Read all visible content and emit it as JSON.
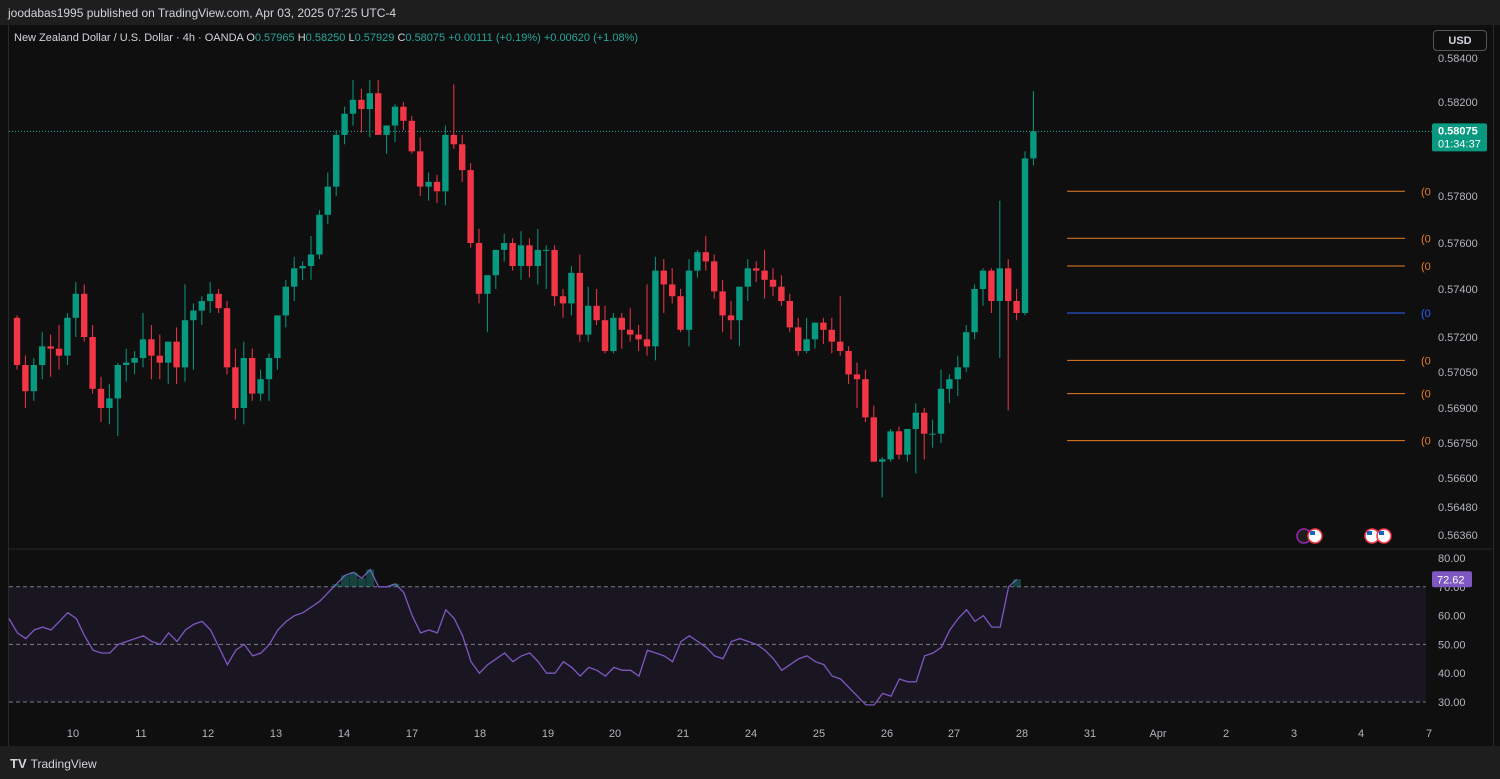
{
  "header": {
    "published": "joodabas1995 published on TradingView.com, Apr 03, 2025 07:25 UTC-4"
  },
  "legend": {
    "symbol": "New Zealand Dollar / U.S. Dollar · 4h · OANDA",
    "o_key": "O",
    "o_val": "0.57965",
    "h_key": "H",
    "h_val": "0.58250",
    "l_key": "L",
    "l_val": "0.57929",
    "c_key": "C",
    "c_val": "0.58075",
    "change": "+0.00111 (+0.19%)",
    "change2": "+0.00620 (+1.08%)"
  },
  "currency_button": "USD",
  "price_badge": {
    "price": "0.58075",
    "countdown": "01:34:37"
  },
  "rsi_badge": "72.62",
  "footer": {
    "brand": "TradingView",
    "logo": "TV"
  },
  "colors": {
    "up": "#089981",
    "down": "#f23645",
    "fib_orange": "#e67e22",
    "fib_blue": "#2962ff",
    "rsi": "#7e57c2",
    "last_price": "#26a69a"
  },
  "chart_data": [
    {
      "type": "candlestick",
      "y_ticks": [
        "0.58400",
        "0.58200",
        "0.57800",
        "0.57600",
        "0.57400",
        "0.57200",
        "0.57050",
        "0.56900",
        "0.56750",
        "0.56600",
        "0.56480",
        "0.56360"
      ],
      "y_tick_values": [
        0.584,
        0.582,
        0.578,
        0.576,
        0.574,
        0.572,
        0.5705,
        0.569,
        0.5675,
        0.566,
        0.5648,
        0.5636
      ],
      "x_ticks": [
        "10",
        "11",
        "12",
        "13",
        "14",
        "17",
        "18",
        "19",
        "20",
        "21",
        "24",
        "25",
        "26",
        "27",
        "28",
        "31",
        "Apr",
        "2",
        "3",
        "4",
        "7"
      ],
      "last_price": 0.58075,
      "fib_levels": [
        {
          "label": "(0",
          "value": 0.5782,
          "color": "orange"
        },
        {
          "label": "(0",
          "value": 0.5762,
          "color": "orange"
        },
        {
          "label": "(0",
          "value": 0.575,
          "color": "orange"
        },
        {
          "label": "(0",
          "value": 0.573,
          "color": "blue"
        },
        {
          "label": "(0",
          "value": 0.571,
          "color": "orange"
        },
        {
          "label": "(0",
          "value": 0.5696,
          "color": "orange"
        },
        {
          "label": "(0",
          "value": 0.5676,
          "color": "orange"
        }
      ],
      "candles": [
        [
          0.5728,
          0.5729,
          0.5706,
          0.5708
        ],
        [
          0.5708,
          0.5712,
          0.569,
          0.5697
        ],
        [
          0.5697,
          0.5711,
          0.5693,
          0.5708
        ],
        [
          0.5708,
          0.5722,
          0.5702,
          0.5716
        ],
        [
          0.5716,
          0.5721,
          0.5703,
          0.5715
        ],
        [
          0.5715,
          0.5725,
          0.5706,
          0.5712
        ],
        [
          0.5712,
          0.573,
          0.5708,
          0.5728
        ],
        [
          0.5728,
          0.5743,
          0.572,
          0.5738
        ],
        [
          0.5738,
          0.5742,
          0.5718,
          0.572
        ],
        [
          0.572,
          0.5725,
          0.5696,
          0.5698
        ],
        [
          0.5698,
          0.5703,
          0.5684,
          0.569
        ],
        [
          0.569,
          0.57,
          0.5683,
          0.5694
        ],
        [
          0.5694,
          0.5709,
          0.5678,
          0.5708
        ],
        [
          0.5708,
          0.5715,
          0.5701,
          0.5709
        ],
        [
          0.5709,
          0.5714,
          0.5704,
          0.5711
        ],
        [
          0.5711,
          0.573,
          0.5707,
          0.5719
        ],
        [
          0.5719,
          0.5725,
          0.5702,
          0.5712
        ],
        [
          0.5712,
          0.5721,
          0.5702,
          0.5709
        ],
        [
          0.5709,
          0.5718,
          0.57,
          0.5718
        ],
        [
          0.5718,
          0.5724,
          0.57,
          0.5707
        ],
        [
          0.5707,
          0.5742,
          0.5701,
          0.5727
        ],
        [
          0.5727,
          0.5734,
          0.5706,
          0.5731
        ],
        [
          0.5731,
          0.5737,
          0.5725,
          0.5735
        ],
        [
          0.5735,
          0.5743,
          0.573,
          0.5738
        ],
        [
          0.5738,
          0.574,
          0.573,
          0.5732
        ],
        [
          0.5732,
          0.5735,
          0.5704,
          0.5707
        ],
        [
          0.5707,
          0.5715,
          0.5685,
          0.569
        ],
        [
          0.569,
          0.5718,
          0.5683,
          0.5711
        ],
        [
          0.5711,
          0.5715,
          0.5693,
          0.5696
        ],
        [
          0.5696,
          0.5706,
          0.5693,
          0.5702
        ],
        [
          0.5702,
          0.5713,
          0.5693,
          0.5711
        ],
        [
          0.5711,
          0.5729,
          0.5706,
          0.5729
        ],
        [
          0.5729,
          0.5744,
          0.5724,
          0.5741
        ],
        [
          0.5741,
          0.5754,
          0.5735,
          0.5749
        ],
        [
          0.5749,
          0.5752,
          0.5744,
          0.575
        ],
        [
          0.575,
          0.5763,
          0.5744,
          0.5755
        ],
        [
          0.5755,
          0.5774,
          0.5753,
          0.5772
        ],
        [
          0.5772,
          0.579,
          0.5768,
          0.5784
        ],
        [
          0.5784,
          0.5808,
          0.578,
          0.5806
        ],
        [
          0.5806,
          0.5818,
          0.5802,
          0.5815
        ],
        [
          0.5815,
          0.583,
          0.581,
          0.5821
        ],
        [
          0.5821,
          0.5826,
          0.5807,
          0.5817
        ],
        [
          0.5817,
          0.583,
          0.5805,
          0.5824
        ],
        [
          0.5824,
          0.583,
          0.5807,
          0.5806
        ],
        [
          0.5806,
          0.5808,
          0.5798,
          0.581
        ],
        [
          0.581,
          0.5819,
          0.5803,
          0.5818
        ],
        [
          0.5818,
          0.582,
          0.5808,
          0.5812
        ],
        [
          0.5812,
          0.5814,
          0.5798,
          0.5799
        ],
        [
          0.5799,
          0.5805,
          0.578,
          0.5784
        ],
        [
          0.5784,
          0.579,
          0.5778,
          0.5786
        ],
        [
          0.5786,
          0.5789,
          0.5777,
          0.5782
        ],
        [
          0.5782,
          0.581,
          0.5776,
          0.5806
        ],
        [
          0.5806,
          0.5828,
          0.58,
          0.5802
        ],
        [
          0.5802,
          0.5806,
          0.5786,
          0.5791
        ],
        [
          0.5791,
          0.5794,
          0.5758,
          0.576
        ],
        [
          0.576,
          0.5766,
          0.5734,
          0.5738
        ],
        [
          0.5738,
          0.5741,
          0.5722,
          0.5746
        ],
        [
          0.5746,
          0.5748,
          0.574,
          0.5757
        ],
        [
          0.5757,
          0.5764,
          0.5752,
          0.576
        ],
        [
          0.576,
          0.5762,
          0.5748,
          0.575
        ],
        [
          0.575,
          0.5765,
          0.5744,
          0.5759
        ],
        [
          0.5759,
          0.5762,
          0.5745,
          0.575
        ],
        [
          0.575,
          0.5766,
          0.5742,
          0.5757
        ],
        [
          0.5757,
          0.5759,
          0.574,
          0.5757
        ],
        [
          0.5757,
          0.5759,
          0.5733,
          0.5737
        ],
        [
          0.5737,
          0.574,
          0.5728,
          0.5734
        ],
        [
          0.5734,
          0.575,
          0.5729,
          0.5747
        ],
        [
          0.5747,
          0.5755,
          0.5718,
          0.5721
        ],
        [
          0.5721,
          0.5741,
          0.5718,
          0.5733
        ],
        [
          0.5733,
          0.574,
          0.5725,
          0.5727
        ],
        [
          0.5727,
          0.5733,
          0.5713,
          0.5714
        ],
        [
          0.5714,
          0.573,
          0.5713,
          0.5728
        ],
        [
          0.5728,
          0.573,
          0.5715,
          0.5723
        ],
        [
          0.5723,
          0.5732,
          0.5718,
          0.5721
        ],
        [
          0.5721,
          0.5725,
          0.5714,
          0.5719
        ],
        [
          0.5719,
          0.5742,
          0.5712,
          0.5716
        ],
        [
          0.5716,
          0.5754,
          0.571,
          0.5748
        ],
        [
          0.5748,
          0.5753,
          0.573,
          0.5742
        ],
        [
          0.5742,
          0.5749,
          0.5734,
          0.5737
        ],
        [
          0.5737,
          0.574,
          0.5722,
          0.5723
        ],
        [
          0.5723,
          0.5753,
          0.5716,
          0.5748
        ],
        [
          0.5748,
          0.5757,
          0.5745,
          0.5756
        ],
        [
          0.5756,
          0.5763,
          0.5748,
          0.5752
        ],
        [
          0.5752,
          0.5755,
          0.5736,
          0.5739
        ],
        [
          0.5739,
          0.5744,
          0.5722,
          0.5729
        ],
        [
          0.5729,
          0.5735,
          0.5719,
          0.5727
        ],
        [
          0.5727,
          0.5741,
          0.5716,
          0.5741
        ],
        [
          0.5741,
          0.5753,
          0.5735,
          0.5749
        ],
        [
          0.5749,
          0.5752,
          0.5743,
          0.5748
        ],
        [
          0.5748,
          0.5757,
          0.5736,
          0.5744
        ],
        [
          0.5744,
          0.5749,
          0.5737,
          0.5741
        ],
        [
          0.5741,
          0.5746,
          0.5733,
          0.5735
        ],
        [
          0.5735,
          0.5738,
          0.5722,
          0.5724
        ],
        [
          0.5724,
          0.5728,
          0.5712,
          0.5714
        ],
        [
          0.5714,
          0.5728,
          0.5713,
          0.5719
        ],
        [
          0.5719,
          0.5726,
          0.5715,
          0.5726
        ],
        [
          0.5726,
          0.5728,
          0.5717,
          0.5723
        ],
        [
          0.5723,
          0.5728,
          0.5713,
          0.5718
        ],
        [
          0.5718,
          0.5737,
          0.5712,
          0.5714
        ],
        [
          0.5714,
          0.5716,
          0.57,
          0.5704
        ],
        [
          0.5704,
          0.5709,
          0.569,
          0.5702
        ],
        [
          0.5702,
          0.5706,
          0.5684,
          0.5686
        ],
        [
          0.5686,
          0.5691,
          0.5667,
          0.5667
        ],
        [
          0.5667,
          0.5669,
          0.5652,
          0.5668
        ],
        [
          0.5668,
          0.5681,
          0.5667,
          0.568
        ],
        [
          0.568,
          0.5682,
          0.5668,
          0.567
        ],
        [
          0.567,
          0.5681,
          0.5667,
          0.5681
        ],
        [
          0.5681,
          0.5692,
          0.5662,
          0.5688
        ],
        [
          0.5688,
          0.569,
          0.5668,
          0.5679
        ],
        [
          0.5679,
          0.5685,
          0.5673,
          0.5679
        ],
        [
          0.5679,
          0.5706,
          0.5675,
          0.5698
        ],
        [
          0.5698,
          0.5704,
          0.5692,
          0.5702
        ],
        [
          0.5702,
          0.5712,
          0.5695,
          0.5707
        ],
        [
          0.5707,
          0.5725,
          0.5705,
          0.5722
        ],
        [
          0.5722,
          0.5742,
          0.5719,
          0.574
        ],
        [
          0.574,
          0.5749,
          0.5733,
          0.5748
        ],
        [
          0.5748,
          0.5749,
          0.573,
          0.5735
        ],
        [
          0.5735,
          0.5778,
          0.5711,
          0.5749
        ],
        [
          0.5749,
          0.5753,
          0.5689,
          0.5735
        ],
        [
          0.5735,
          0.574,
          0.5727,
          0.573
        ],
        [
          0.573,
          0.5799,
          0.5729,
          0.5796
        ],
        [
          0.5796,
          0.5825,
          0.5793,
          0.58075
        ]
      ]
    },
    {
      "type": "line",
      "name": "RSI",
      "y_ticks": [
        "80.00",
        "70.00",
        "60.00",
        "50.00",
        "40.00",
        "30.00"
      ],
      "y_tick_values": [
        80,
        70,
        60,
        50,
        40,
        30
      ],
      "bands": [
        70,
        50,
        30
      ],
      "values": [
        59,
        54,
        52,
        55,
        56,
        55,
        58,
        61,
        59,
        53,
        48,
        47,
        47,
        50,
        51,
        52,
        53,
        51,
        50,
        54,
        51,
        55,
        57,
        58,
        55,
        49,
        43,
        48,
        50,
        46,
        47,
        50,
        55,
        58,
        60,
        61,
        63,
        65,
        68,
        71,
        74,
        75,
        73,
        76,
        70,
        70,
        71,
        68,
        60,
        54,
        55,
        54,
        62,
        59,
        53,
        44,
        40,
        43,
        45,
        47,
        44,
        46,
        47,
        44,
        40,
        40,
        44,
        42,
        39,
        42,
        41,
        39,
        42,
        41,
        41,
        39,
        48,
        47,
        46,
        44,
        51,
        53,
        51,
        49,
        46,
        45,
        51,
        52,
        51,
        50,
        48,
        45,
        41,
        43,
        45,
        46,
        44,
        43,
        39,
        38,
        35,
        32,
        29,
        29,
        33,
        32,
        38,
        37,
        37,
        46,
        47,
        49,
        55,
        59,
        62,
        58,
        60,
        56,
        56,
        70,
        72.62
      ]
    }
  ]
}
